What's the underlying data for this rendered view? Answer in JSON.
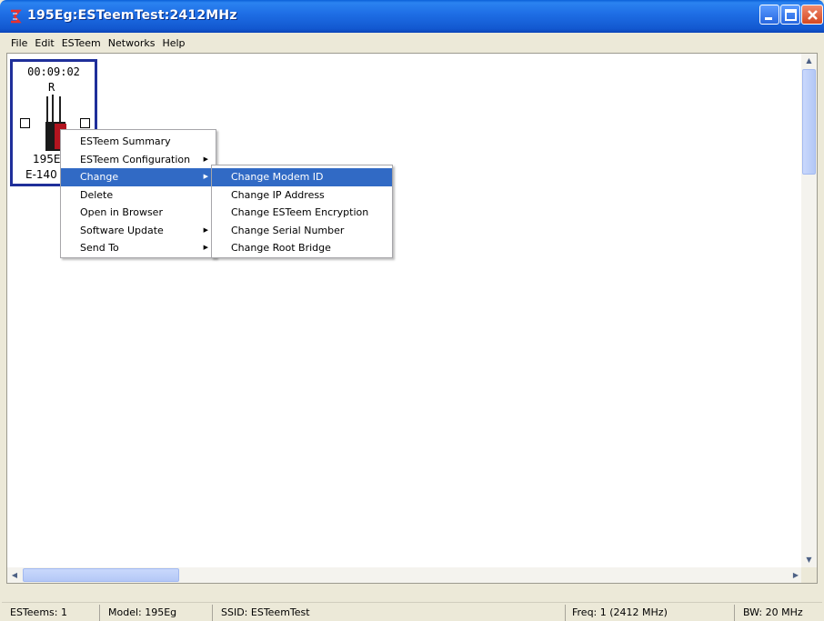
{
  "window": {
    "title": "195Eg:ESTeemTest:2412MHz"
  },
  "menubar": {
    "items": [
      "File",
      "Edit",
      "ESTeem",
      "Networks",
      "Help"
    ]
  },
  "device_node": {
    "uptime": "00:09:02",
    "role": "R",
    "name": "195E",
    "id": "E-140"
  },
  "context_menu": {
    "items": [
      {
        "label": "ESTeem Summary",
        "has_submenu": false
      },
      {
        "label": "ESTeem Configuration",
        "has_submenu": true
      },
      {
        "label": "Change",
        "has_submenu": true,
        "selected": true
      },
      {
        "label": "Delete",
        "has_submenu": false
      },
      {
        "label": "Open in Browser",
        "has_submenu": false
      },
      {
        "label": "Software Update",
        "has_submenu": true
      },
      {
        "label": "Send To",
        "has_submenu": true
      }
    ]
  },
  "change_submenu": {
    "items": [
      {
        "label": "Change Modem ID",
        "selected": true
      },
      {
        "label": "Change IP Address"
      },
      {
        "label": "Change ESTeem Encryption"
      },
      {
        "label": "Change Serial Number"
      },
      {
        "label": "Change Root Bridge"
      }
    ]
  },
  "statusbar": {
    "esteems": "ESTeems: 1",
    "model": "Model: 195Eg",
    "ssid": "SSID: ESTeemTest",
    "freq": "Freq: 1 (2412 MHz)",
    "bw": "BW: 20 MHz"
  },
  "colors": {
    "titlebar": "#1F6FE6",
    "selection": "#316AC5",
    "node_border": "#1F2F9A",
    "chrome": "#ECE9D8"
  }
}
